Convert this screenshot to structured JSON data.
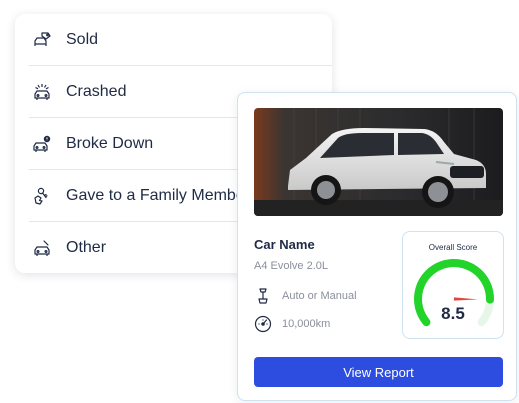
{
  "menu": {
    "items": [
      {
        "label": "Sold",
        "icon": "car-sale-tag-icon"
      },
      {
        "label": "Crashed",
        "icon": "car-crash-icon"
      },
      {
        "label": "Broke Down",
        "icon": "car-broken-icon"
      },
      {
        "label": "Gave to a Family Member",
        "icon": "hand-keys-icon"
      },
      {
        "label": "Other",
        "icon": "car-other-icon"
      }
    ]
  },
  "car": {
    "name_label": "Car Name",
    "model": "A4 Evolve 2.0L",
    "transmission": "Auto or Manual",
    "mileage": "10,000km",
    "photo": "white-suv-photo"
  },
  "score": {
    "title": "Overall Score",
    "value": "8.5",
    "fraction": 0.85,
    "gauge_color": "#22d32a"
  },
  "actions": {
    "view_report": "View Report"
  },
  "colors": {
    "accent": "#2d4de0",
    "text": "#1f2a44",
    "muted": "#8a8f9c"
  }
}
